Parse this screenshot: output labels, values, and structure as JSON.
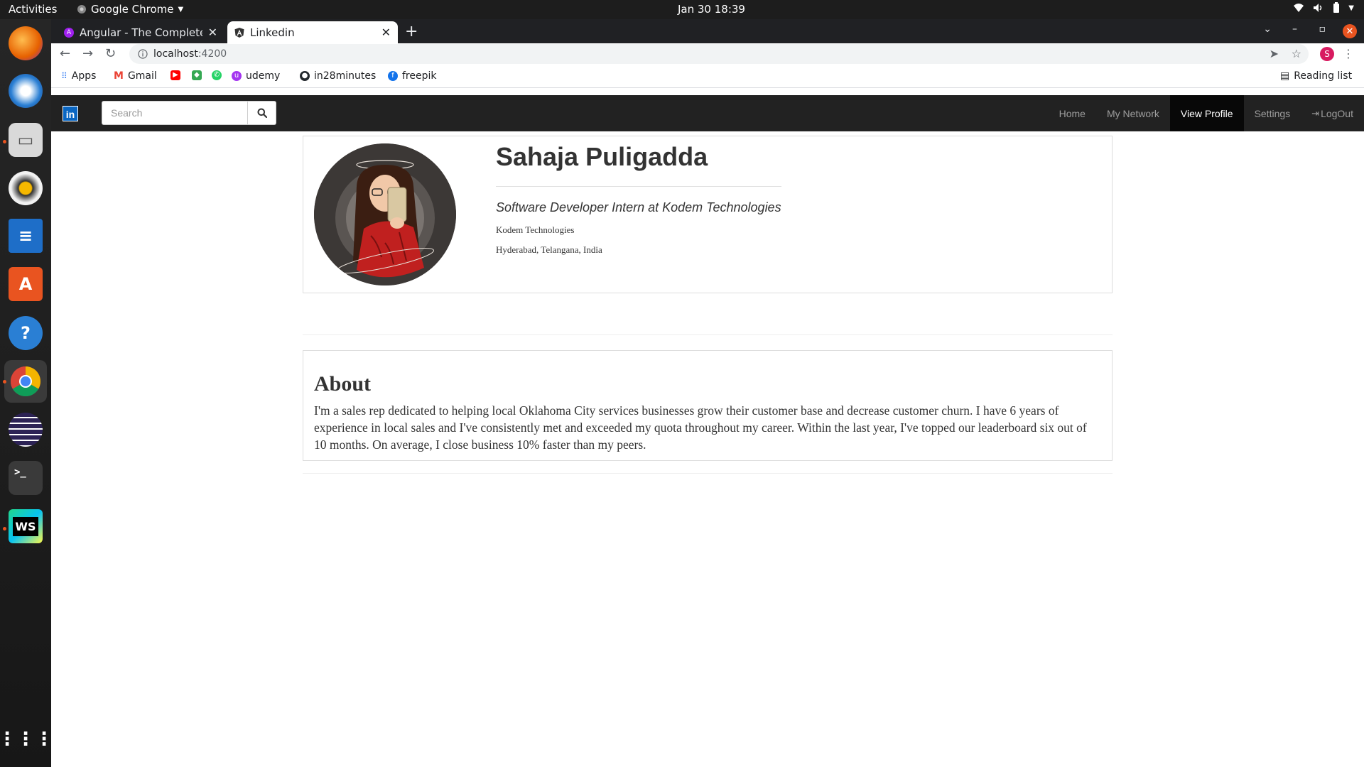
{
  "system": {
    "activities": "Activities",
    "app_name": "Google Chrome",
    "clock": "Jan 30  18:39"
  },
  "browser": {
    "tabs": [
      {
        "title": "Angular - The Complete G",
        "active": false
      },
      {
        "title": "Linkedin",
        "active": true
      }
    ],
    "address": {
      "host": "localhost",
      "port": ":4200"
    },
    "profile_initial": "S",
    "bookmarks": [
      "Apps",
      "Gmail",
      "udemy",
      "in28minutes",
      "freepik"
    ],
    "reading_list": "Reading list"
  },
  "navbar": {
    "logo_text": "in",
    "search_placeholder": "Search",
    "links": [
      "Home",
      "My Network",
      "View Profile",
      "Settings",
      "LogOut"
    ],
    "active_link": "View Profile"
  },
  "profile": {
    "name": "Sahaja Puligadda",
    "headline": "Software Developer Intern at Kodem Technologies",
    "company": "Kodem Technologies",
    "location": "Hyderabad, Telangana, India"
  },
  "about": {
    "title": "About",
    "text": "I'm a sales rep dedicated to helping local Oklahoma City services businesses grow their customer base and decrease customer churn. I have 6 years of experience in local sales and I've consistently met and exceeded my quota throughout my career. Within the last year, I've topped our leaderboard six out of 10 months. On average, I close business 10% faster than my peers."
  }
}
